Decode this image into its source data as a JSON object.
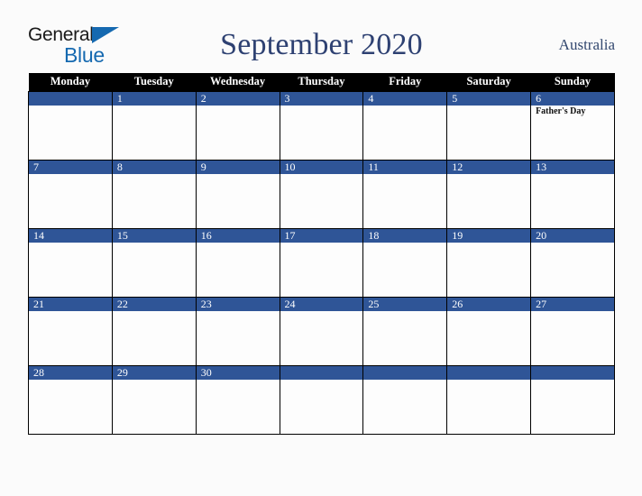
{
  "brand": {
    "name_part1": "General",
    "name_part2": "Blue",
    "triangle_icon": "blue-triangle-icon",
    "color_dark": "#1a1a1a",
    "color_blue": "#1569b0"
  },
  "header": {
    "title": "September 2020",
    "country": "Australia",
    "title_color": "#2e4172",
    "country_color": "#33486f"
  },
  "calendar": {
    "header_bg": "#000000",
    "header_text_color": "#ffffff",
    "daynum_bg": "#2f5597",
    "daynum_text_color": "#ffffff",
    "cell_bg": "#fdfdfd",
    "border_color": "#000000",
    "weekdays": [
      "Monday",
      "Tuesday",
      "Wednesday",
      "Thursday",
      "Friday",
      "Saturday",
      "Sunday"
    ],
    "weeks": [
      [
        {
          "date": "",
          "event": ""
        },
        {
          "date": "1",
          "event": ""
        },
        {
          "date": "2",
          "event": ""
        },
        {
          "date": "3",
          "event": ""
        },
        {
          "date": "4",
          "event": ""
        },
        {
          "date": "5",
          "event": ""
        },
        {
          "date": "6",
          "event": "Father's Day"
        }
      ],
      [
        {
          "date": "7",
          "event": ""
        },
        {
          "date": "8",
          "event": ""
        },
        {
          "date": "9",
          "event": ""
        },
        {
          "date": "10",
          "event": ""
        },
        {
          "date": "11",
          "event": ""
        },
        {
          "date": "12",
          "event": ""
        },
        {
          "date": "13",
          "event": ""
        }
      ],
      [
        {
          "date": "14",
          "event": ""
        },
        {
          "date": "15",
          "event": ""
        },
        {
          "date": "16",
          "event": ""
        },
        {
          "date": "17",
          "event": ""
        },
        {
          "date": "18",
          "event": ""
        },
        {
          "date": "19",
          "event": ""
        },
        {
          "date": "20",
          "event": ""
        }
      ],
      [
        {
          "date": "21",
          "event": ""
        },
        {
          "date": "22",
          "event": ""
        },
        {
          "date": "23",
          "event": ""
        },
        {
          "date": "24",
          "event": ""
        },
        {
          "date": "25",
          "event": ""
        },
        {
          "date": "26",
          "event": ""
        },
        {
          "date": "27",
          "event": ""
        }
      ],
      [
        {
          "date": "28",
          "event": ""
        },
        {
          "date": "29",
          "event": ""
        },
        {
          "date": "30",
          "event": ""
        },
        {
          "date": "",
          "event": ""
        },
        {
          "date": "",
          "event": ""
        },
        {
          "date": "",
          "event": ""
        },
        {
          "date": "",
          "event": ""
        }
      ]
    ]
  }
}
